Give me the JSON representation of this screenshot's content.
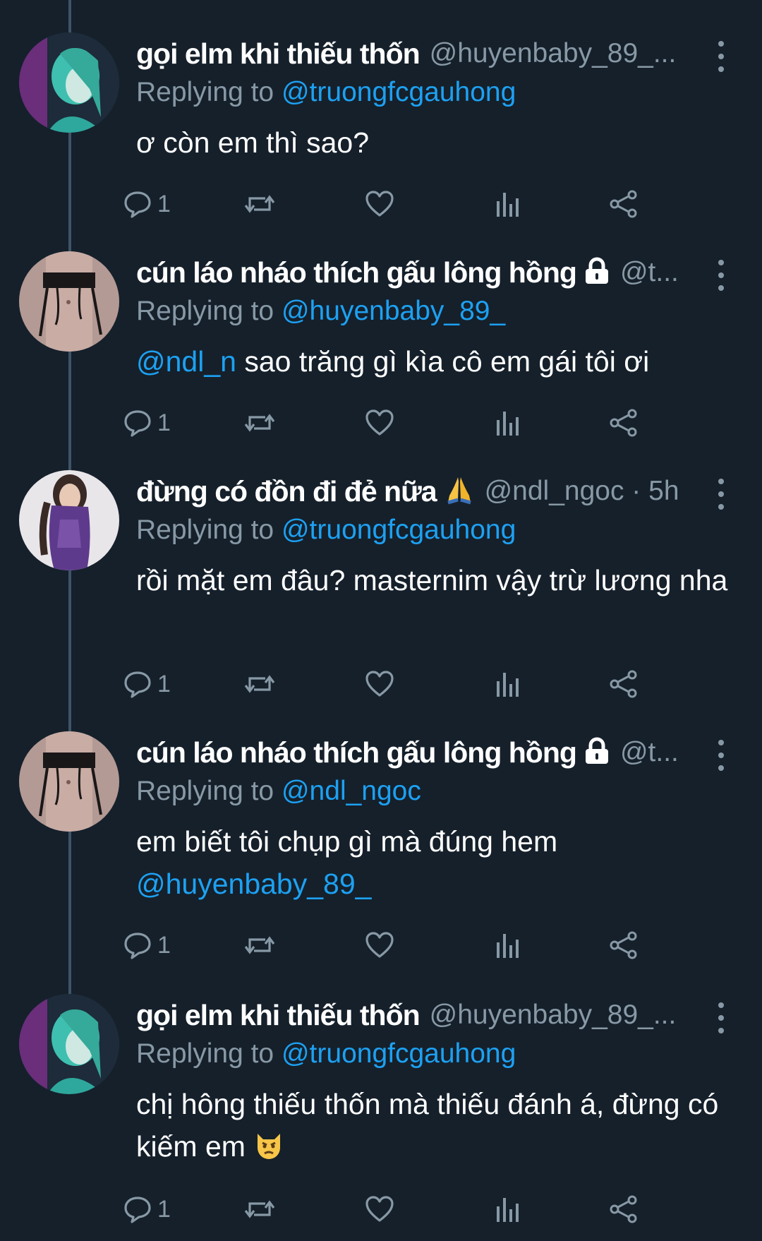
{
  "colors": {
    "background": "#15202b",
    "text": "#ffffff",
    "muted": "#8899a6",
    "link": "#1da1f2"
  },
  "tweets": [
    {
      "avatar": "teal-portrait-avatar",
      "display_name": "gọi elm khi thiếu thốn",
      "handle": "@huyenbaby_89_...",
      "replying_label": "Replying to",
      "replying_to": "@truongfcgauhong",
      "text_mention": "",
      "text": "ơ còn em thì sao?",
      "text_mention_after": "",
      "reply_count": "1"
    },
    {
      "avatar": "torso-avatar",
      "display_name": "cún láo nháo thích gấu lông hồng",
      "name_icon": "lock-icon",
      "handle": "@t...",
      "replying_label": "Replying to",
      "replying_to": "@huyenbaby_89_",
      "text_mention": "@ndl_n",
      "text": " sao trăng gì kìa cô em gái tôi ơi",
      "text_mention_after": "",
      "reply_count": "1"
    },
    {
      "avatar": "purple-dress-avatar",
      "display_name": "đừng có đồn đi đẻ nữa",
      "name_icon": "folded-hands-emoji",
      "handle": "@ndl_ngoc · 5h",
      "replying_label": "Replying to",
      "replying_to": "@truongfcgauhong",
      "text_mention": "",
      "text": "rồi mặt em đâu? masternim vậy trừ lương nha",
      "text_mention_after": "",
      "reply_count": "1"
    },
    {
      "avatar": "torso-avatar",
      "display_name": "cún láo nháo thích gấu lông hồng",
      "name_icon": "lock-icon",
      "handle": "@t...",
      "replying_label": "Replying to",
      "replying_to": "@ndl_ngoc",
      "text_mention": "",
      "text": "em biết tôi chụp gì mà đúng hem ",
      "text_mention_after": "@huyenbaby_89_",
      "reply_count": "1"
    },
    {
      "avatar": "teal-portrait-avatar",
      "display_name": "gọi elm khi thiếu thốn",
      "handle": "@huyenbaby_89_...",
      "replying_label": "Replying to",
      "replying_to": "@truongfcgauhong",
      "text_mention": "",
      "text": "chị hông thiếu thốn mà thiếu đánh á, đừng có kiếm em",
      "text_emoji": "pouting-cat-emoji",
      "text_mention_after": "",
      "reply_count": "1"
    }
  ]
}
